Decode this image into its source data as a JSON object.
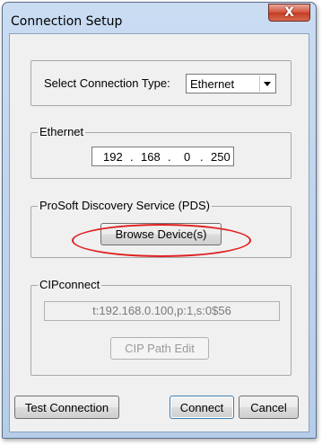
{
  "window": {
    "title": "Connection Setup",
    "close_glyph": "X"
  },
  "connection_type": {
    "label": "Select Connection Type:",
    "value": "Ethernet"
  },
  "ethernet": {
    "group_label": "Ethernet",
    "ip": [
      "192",
      "168",
      "0",
      "250"
    ],
    "dot": "."
  },
  "pds": {
    "group_label": "ProSoft Discovery Service (PDS)",
    "browse_button": "Browse Device(s)"
  },
  "cipconnect": {
    "group_label": "CIPconnect",
    "path_value": "t:192.168.0.100,p:1,s:0$56",
    "path_edit_button": "CIP Path Edit"
  },
  "footer": {
    "test_button": "Test Connection",
    "connect_button": "Connect",
    "cancel_button": "Cancel"
  },
  "colors": {
    "highlight": "#e02020",
    "title_gradient_top": "#c9dcf2",
    "close_button": "#c43a24"
  }
}
